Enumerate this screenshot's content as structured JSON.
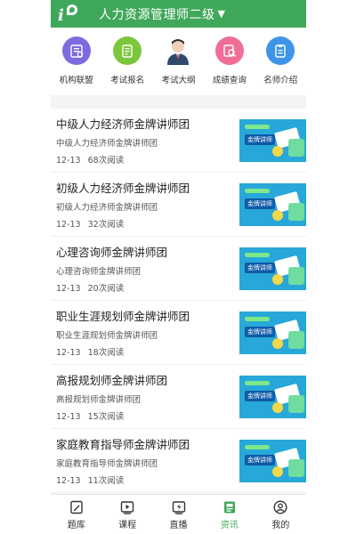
{
  "header": {
    "title": "人力资源管理师二级",
    "caret": "▼",
    "logo_icon": "brand-logo-icon",
    "bg": "#40a85a"
  },
  "quick_nav": [
    {
      "label": "机构联盟",
      "icon": "organization-icon",
      "color": "#7d6be0"
    },
    {
      "label": "考试报名",
      "icon": "clipboard-icon",
      "color": "#7cc63c"
    },
    {
      "label": "考试大纲",
      "icon": "teacher-avatar-icon",
      "color": "#ffffff"
    },
    {
      "label": "成绩查询",
      "icon": "search-doc-icon",
      "color": "#f06e96"
    },
    {
      "label": "名师介绍",
      "icon": "id-card-icon",
      "color": "#3e95e8"
    }
  ],
  "articles": [
    {
      "title": "中级人力经济师金牌讲师团",
      "subtitle": "中级人力经济师金牌讲师团",
      "date": "12-13",
      "reads": "68次阅读"
    },
    {
      "title": "初级人力经济师金牌讲师团",
      "subtitle": "初级人力经济师金牌讲师团",
      "date": "12-13",
      "reads": "32次阅读"
    },
    {
      "title": "心理咨询师金牌讲师团",
      "subtitle": "心理咨询师金牌讲师团",
      "date": "12-13",
      "reads": "20次阅读"
    },
    {
      "title": "职业生涯规划师金牌讲师团",
      "subtitle": "职业生涯规划师金牌讲师团",
      "date": "12-13",
      "reads": "18次阅读"
    },
    {
      "title": "高报规划师金牌讲师团",
      "subtitle": "高报规划师金牌讲师团",
      "date": "12-13",
      "reads": "15次阅读"
    },
    {
      "title": "家庭教育指导师金牌讲师团",
      "subtitle": "家庭教育指导师金牌讲师团",
      "date": "12-13",
      "reads": "11次阅读"
    }
  ],
  "thumb_tag": "金牌讲师",
  "tabbar": [
    {
      "label": "题库",
      "icon": "question-bank-icon",
      "active": false
    },
    {
      "label": "课程",
      "icon": "video-course-icon",
      "active": false
    },
    {
      "label": "直播",
      "icon": "live-icon",
      "active": false
    },
    {
      "label": "资讯",
      "icon": "news-icon",
      "active": true
    },
    {
      "label": "我的",
      "icon": "profile-icon",
      "active": false
    }
  ],
  "colors": {
    "accent": "#40a85a",
    "banner": "#28a8d8"
  }
}
